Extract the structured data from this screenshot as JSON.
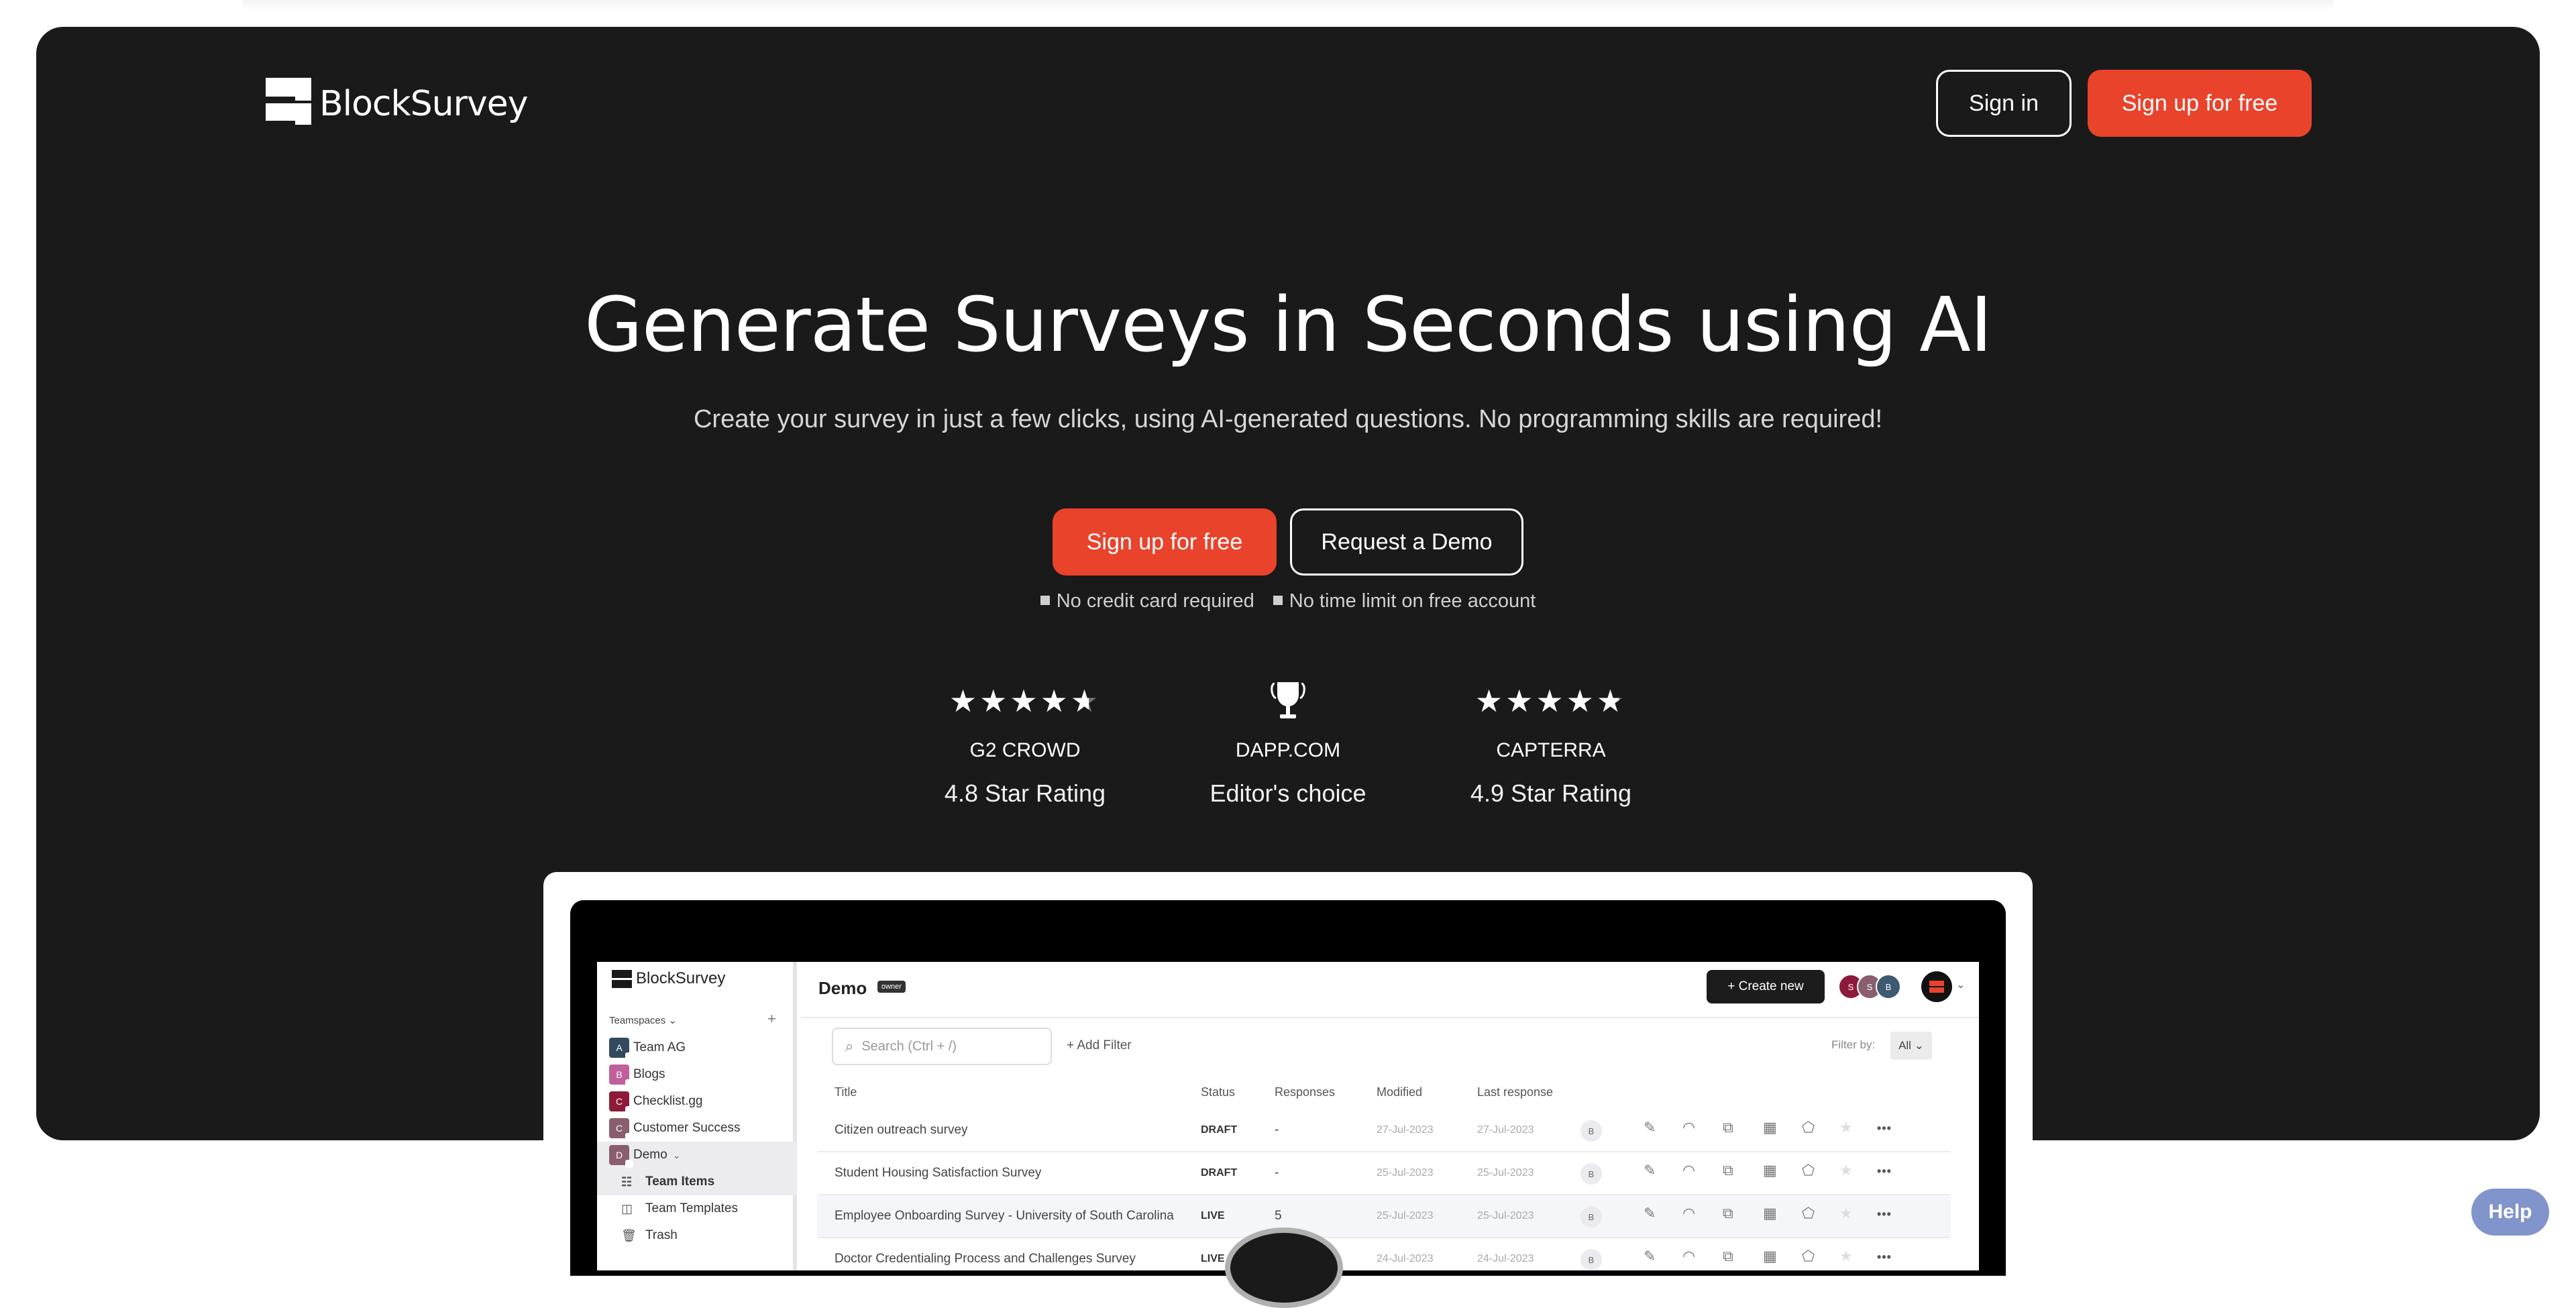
{
  "brand": {
    "name": "BlockSurvey"
  },
  "nav": {
    "signin_label": "Sign in",
    "signup_label": "Sign up for free"
  },
  "hero": {
    "headline": "Generate Surveys in Seconds using AI",
    "subheadline": "Create your survey in just a few clicks, using AI-generated questions. No programming skills are required!",
    "cta_primary": "Sign up for free",
    "cta_secondary": "Request a Demo",
    "notes": [
      "No credit card required",
      "No time limit on free account"
    ]
  },
  "ratings": [
    {
      "icon": "stars-icon",
      "stars": 4.8,
      "source": "G2 CROWD",
      "label": "4.8 Star Rating"
    },
    {
      "icon": "trophy-icon",
      "source": "DAPP.COM",
      "label": "Editor's choice"
    },
    {
      "icon": "stars-icon",
      "stars": 4.9,
      "source": "CAPTERRA",
      "label": "4.9 Star Rating"
    }
  ],
  "app_preview": {
    "brand": "BlockSurvey",
    "sidebar": {
      "section_label": "Teamspaces",
      "teamspaces": [
        {
          "initial": "A",
          "name": "Team AG",
          "color": "#34495e"
        },
        {
          "initial": "B",
          "name": "Blogs",
          "color": "#c0609a"
        },
        {
          "initial": "C",
          "name": "Checklist.gg",
          "color": "#8e1a3a"
        },
        {
          "initial": "C",
          "name": "Customer Success",
          "color": "#8a5e6e"
        },
        {
          "initial": "D",
          "name": "Demo",
          "color": "#8a5e6e"
        }
      ],
      "sub_items": [
        {
          "icon": "list-icon",
          "label": "Team Items"
        },
        {
          "icon": "template-icon",
          "label": "Team Templates"
        },
        {
          "icon": "trash-icon",
          "label": "Trash"
        }
      ]
    },
    "header": {
      "title": "Demo",
      "role_badge": "owner",
      "create_label": "+ Create new",
      "members": [
        {
          "initial": "S",
          "color": "#8e1a3a"
        },
        {
          "initial": "S",
          "color": "#8a5e6e"
        },
        {
          "initial": "B",
          "color": "#3d5a70"
        }
      ]
    },
    "toolbar": {
      "search_placeholder": "Search (Ctrl + /)",
      "add_filter_label": "+ Add Filter",
      "filter_by_label": "Filter by:",
      "filter_value": "All"
    },
    "table": {
      "columns": [
        "Title",
        "Status",
        "Responses",
        "Modified",
        "Last response"
      ],
      "rows": [
        {
          "title": "Citizen outreach survey",
          "status": "DRAFT",
          "responses": "-",
          "modified": "27-Jul-2023",
          "last_response": "27-Jul-2023",
          "owner": "B"
        },
        {
          "title": "Student Housing Satisfaction Survey",
          "status": "DRAFT",
          "responses": "-",
          "modified": "25-Jul-2023",
          "last_response": "25-Jul-2023",
          "owner": "B"
        },
        {
          "title": "Employee Onboarding Survey - University of South Carolina",
          "status": "LIVE",
          "responses": "5",
          "modified": "25-Jul-2023",
          "last_response": "25-Jul-2023",
          "owner": "B"
        },
        {
          "title": "Doctor Credentialing Process and Challenges Survey",
          "status": "LIVE",
          "responses": "",
          "modified": "24-Jul-2023",
          "last_response": "24-Jul-2023",
          "owner": "B"
        }
      ]
    }
  },
  "help": {
    "label": "Help",
    "color": "#8194cb"
  },
  "colors": {
    "accent": "#e9432c",
    "hero_bg": "#1a1a1a"
  }
}
